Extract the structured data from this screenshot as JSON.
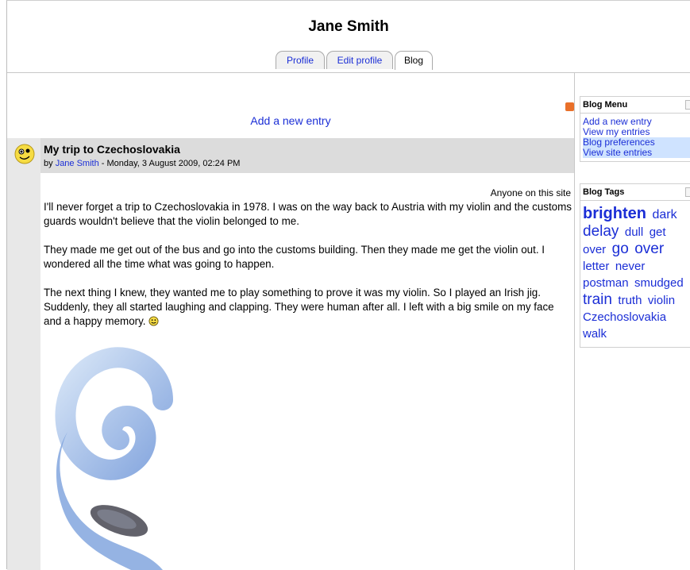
{
  "header": {
    "user_name": "Jane Smith",
    "tabs": [
      {
        "label": "Profile"
      },
      {
        "label": "Edit profile"
      },
      {
        "label": "Blog"
      }
    ]
  },
  "main": {
    "add_entry_label": "Add a new entry",
    "post": {
      "title": "My trip to Czechoslovakia",
      "meta_prefix": "by ",
      "author": "Jane Smith",
      "meta_date": " - Monday, 3 August 2009, 02:24 PM",
      "visibility": "Anyone on this site",
      "paragraphs": [
        "I'll never forget a trip to Czechoslovakia in 1978. I was on the way back to Austria with my violin and the customs guards wouldn't believe that the violin belonged to me.",
        "They made me get out of the bus and go into the customs building. Then they made me get the violin out. I wondered all the time what was going to happen.",
        "The next thing I knew, they wanted me to play something to prove it was my violin. So I played an Irish jig. Suddenly, they all started laughing and clapping. They were human after all. I left with a big smile on my face and a happy memory."
      ]
    }
  },
  "sidebar": {
    "blog_menu": {
      "title": "Blog Menu",
      "items": [
        {
          "label": "Add a new entry"
        },
        {
          "label": "View my entries"
        },
        {
          "label": "Blog preferences"
        },
        {
          "label": "View site entries"
        }
      ]
    },
    "blog_tags": {
      "title": "Blog Tags",
      "tags": [
        {
          "label": "brighten",
          "size": 20
        },
        {
          "label": "dark",
          "size": 16
        },
        {
          "label": "delay",
          "size": 19
        },
        {
          "label": "dull",
          "size": 15
        },
        {
          "label": "get",
          "size": 15
        },
        {
          "label": "over",
          "size": 15
        },
        {
          "label": "go",
          "size": 19
        },
        {
          "label": "over",
          "size": 19
        },
        {
          "label": "letter",
          "size": 15
        },
        {
          "label": "never",
          "size": 15
        },
        {
          "label": "postman",
          "size": 15
        },
        {
          "label": "smudged",
          "size": 15
        },
        {
          "label": "train",
          "size": 19
        },
        {
          "label": "truth",
          "size": 15
        },
        {
          "label": "violin",
          "size": 15
        },
        {
          "label": "Czechoslovakia",
          "size": 15
        },
        {
          "label": "walk",
          "size": 15
        }
      ]
    }
  },
  "colors": {
    "link": "#1b2ed6",
    "post_header_bg": "#dcdcdc",
    "rss": "#e9702a"
  }
}
